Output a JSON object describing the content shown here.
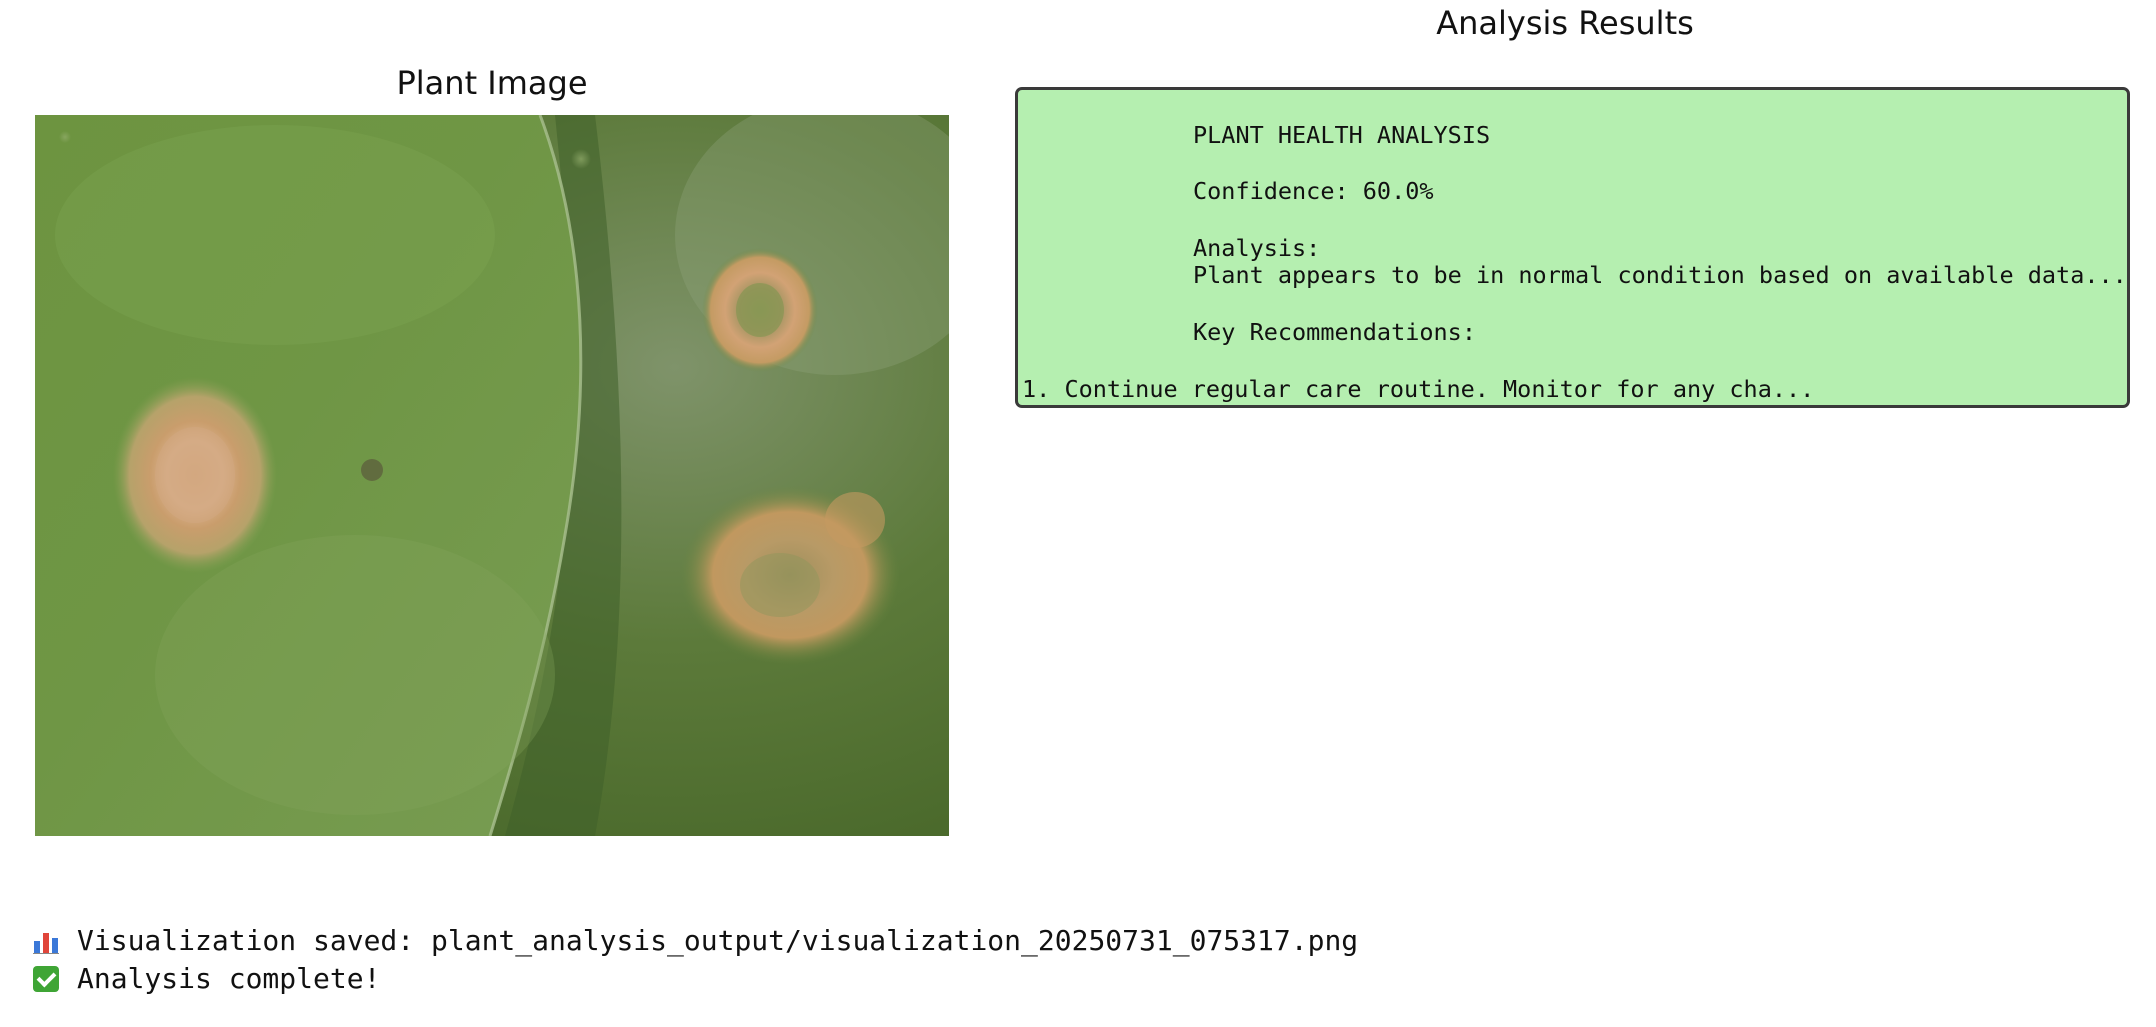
{
  "plant_panel": {
    "title": "Plant Image"
  },
  "results_panel": {
    "title": "Analysis Results",
    "background_color": "#b5efb0",
    "heading": "PLANT HEALTH ANALYSIS",
    "confidence": "Confidence: 60.0%",
    "analysis_label": "Analysis:",
    "analysis_text": "Plant appears to be in normal condition based on available data...",
    "recommendations_label": "Key Recommendations:",
    "recommendation_1": "1. Continue regular care routine. Monitor for any cha..."
  },
  "console": {
    "lines": [
      {
        "icon": "bar-chart-icon",
        "text": "Visualization saved: plant_analysis_output/visualization_20250731_075317.png"
      },
      {
        "icon": "check-mark-icon",
        "text": "Analysis complete!"
      }
    ]
  }
}
